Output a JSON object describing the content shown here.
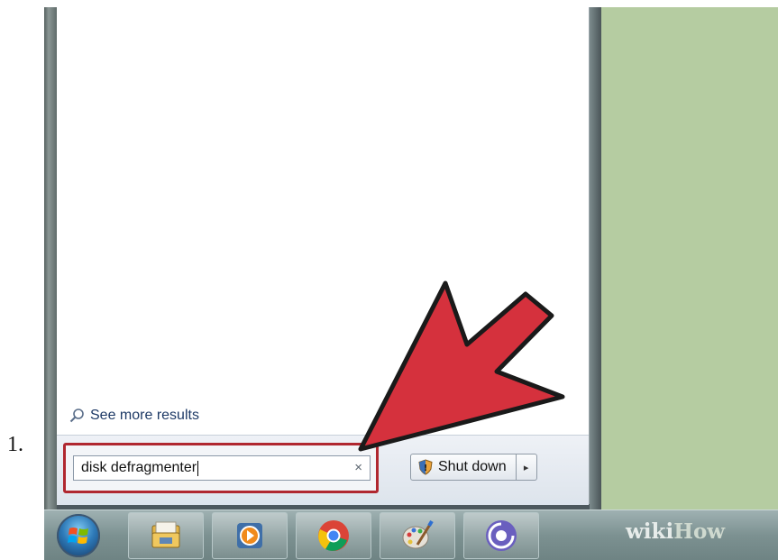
{
  "step": {
    "number": "1."
  },
  "start_menu": {
    "see_more_label": "See more results",
    "search": {
      "value": "disk defragmenter",
      "clear_glyph": "×"
    },
    "shutdown": {
      "label": "Shut down",
      "arrow_glyph": "▸",
      "icon": "shield-icon"
    }
  },
  "taskbar": {
    "items": [
      {
        "icon": "windows-start-orb"
      },
      {
        "icon": "windows-explorer-icon"
      },
      {
        "icon": "media-player-icon"
      },
      {
        "icon": "chrome-icon"
      },
      {
        "icon": "paint-icon"
      },
      {
        "icon": "bittorrent-icon"
      }
    ]
  },
  "watermark": {
    "part1": "wiki",
    "part2": "How"
  },
  "colors": {
    "annotation_arrow": "#d5313d",
    "highlight_border": "#b0272f",
    "desktop": "#b5cca1"
  }
}
